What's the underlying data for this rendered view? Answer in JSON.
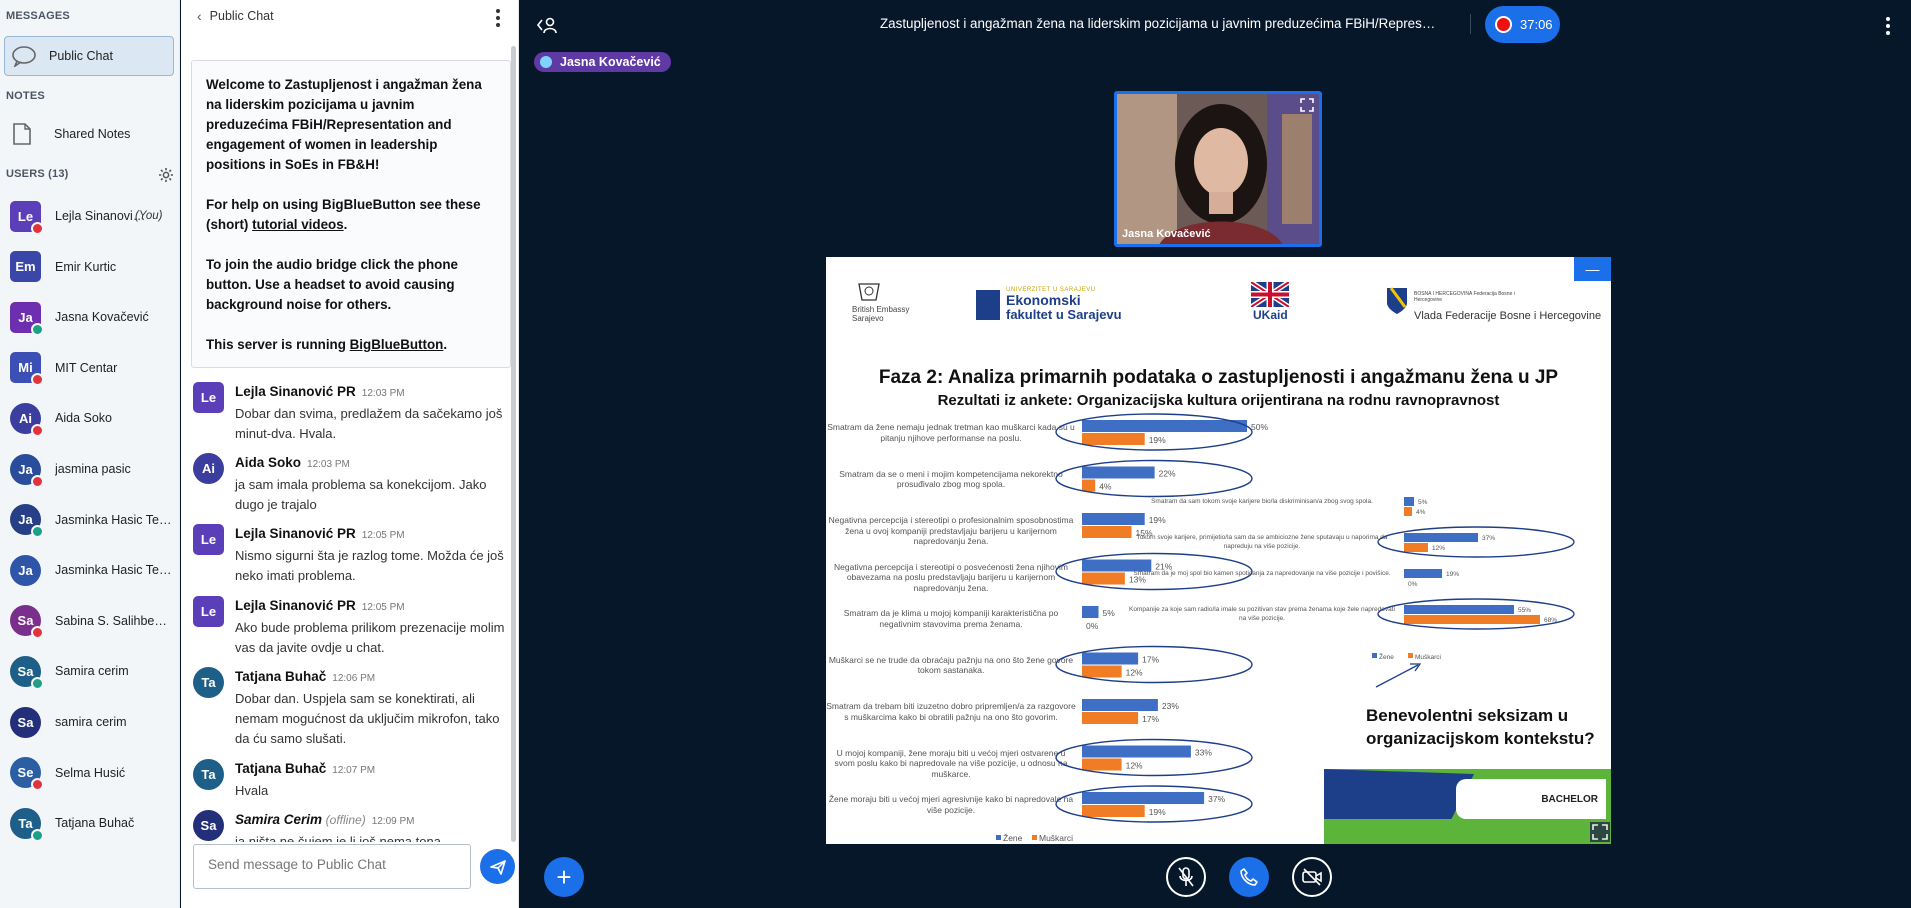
{
  "sidebar": {
    "messages_title": "MESSAGES",
    "public_chat": "Public Chat",
    "notes_title": "NOTES",
    "shared_notes": "Shared Notes",
    "users_title": "USERS (13)",
    "users": [
      {
        "initials": "Le",
        "name": "Lejla Sinanović …",
        "you": "(You)",
        "color": "#5b3fb8",
        "status": "#e0333c",
        "shape": "square"
      },
      {
        "initials": "Em",
        "name": "Emir Kurtic",
        "you": "",
        "color": "#3b47a8",
        "status": "",
        "shape": "square"
      },
      {
        "initials": "Ja",
        "name": "Jasna Kovačević",
        "you": "",
        "color": "#6d2fb0",
        "status": "#1f9f86",
        "shape": "square"
      },
      {
        "initials": "Mi",
        "name": "MIT Centar",
        "you": "",
        "color": "#3b4fb4",
        "status": "#e0333c",
        "shape": "square"
      },
      {
        "initials": "Ai",
        "name": "Aida Soko",
        "you": "",
        "color": "#3b3e9f",
        "status": "#e0333c",
        "shape": "round"
      },
      {
        "initials": "Ja",
        "name": "jasmina pasic",
        "you": "",
        "color": "#2a4d9b",
        "status": "#e0333c",
        "shape": "round"
      },
      {
        "initials": "Ja",
        "name": "Jasminka Hasic Telal…",
        "you": "",
        "color": "#263f86",
        "status": "#1f9f86",
        "shape": "round"
      },
      {
        "initials": "Ja",
        "name": "Jasminka Hasic Telal…",
        "you": "",
        "color": "#2f55a8",
        "status": "",
        "shape": "round"
      },
      {
        "initials": "Sa",
        "name": "Sabina S. Salihbegovic",
        "you": "",
        "color": "#7a2f8c",
        "status": "#e0333c",
        "shape": "round"
      },
      {
        "initials": "Sa",
        "name": "Samira cerim",
        "you": "",
        "color": "#1d5f88",
        "status": "#1f9f86",
        "shape": "round"
      },
      {
        "initials": "Sa",
        "name": "samira cerim",
        "you": "",
        "color": "#242f7a",
        "status": "",
        "shape": "round"
      },
      {
        "initials": "Se",
        "name": "Selma Husić",
        "you": "",
        "color": "#2c5ea4",
        "status": "#e0333c",
        "shape": "round"
      },
      {
        "initials": "Ta",
        "name": "Tatjana Buhač",
        "you": "",
        "color": "#1d5f88",
        "status": "#1f9f86",
        "shape": "round"
      }
    ]
  },
  "chat": {
    "header": "Public Chat",
    "welcome_line1": "Welcome to Zastupljenost i angažman žena na liderskim pozicijama u javnim preduzećima FBiH/Representation and engagement of women in leadership positions in SoEs in FB&H!",
    "welcome_help_pre": "For help on using BigBlueButton see these (short) ",
    "welcome_help_link": "tutorial videos",
    "welcome_audio": "To join the audio bridge click the phone button. Use a headset to avoid causing background noise for others.",
    "welcome_server_pre": "This server is running ",
    "welcome_server_link": "BigBlueButton",
    "messages": [
      {
        "initials": "Le",
        "name": "Lejla Sinanović PR",
        "time": "12:03 PM",
        "text": "Dobar dan svima, predlažem da sačekamo još minut-dva. Hvala.",
        "color": "#5b3fb8"
      },
      {
        "initials": "Ai",
        "name": "Aida Soko",
        "time": "12:03 PM",
        "text": "ja sam imala problema sa konekcijom. Jako dugo je trajalo",
        "color": "#3b3e9f"
      },
      {
        "initials": "Le",
        "name": "Lejla Sinanović PR",
        "time": "12:05 PM",
        "text": "Nismo sigurni šta je razlog tome. Možda će još neko imati problema.",
        "color": "#5b3fb8"
      },
      {
        "initials": "Le",
        "name": "Lejla Sinanović PR",
        "time": "12:05 PM",
        "text": "Ako bude problema prilikom prezenacije molim vas da javite ovdje u chat.",
        "color": "#5b3fb8"
      },
      {
        "initials": "Ta",
        "name": "Tatjana Buhač",
        "time": "12:06 PM",
        "text": "Dobar dan. Uspjela sam se konektirati, ali nemam mogućnost da uključim mikrofon, tako da ću samo slušati.",
        "color": "#1d5f88"
      },
      {
        "initials": "Ta",
        "name": "Tatjana Buhač",
        "time": "12:07 PM",
        "text": "Hvala",
        "color": "#1d5f88"
      },
      {
        "initials": "Sa",
        "name": "Samira Cerim",
        "offline": "(offline)",
        "time": "12:09 PM",
        "text": "ja ništa ne čujem je li još nema tona",
        "color": "#242f7a"
      }
    ],
    "input_placeholder": "Send message to Public Chat"
  },
  "topbar": {
    "title": "Zastupljenost i angažman žena na liderskim pozicijama u javnim preduzećima FBiH/Representation …",
    "timer": "37:06"
  },
  "talker": "Jasna Kovačević",
  "video": {
    "name": "Jasna Kovačević"
  },
  "slide": {
    "logos": {
      "embassy": "British Embassy Sarajevo",
      "univ_top": "UNIVERZITET U SARAJEVU",
      "univ1": "Ekonomski",
      "univ2": "fakultet u Sarajevu",
      "ukaid": "UKaid",
      "vlada_small": "BOSNA I HERCEGOVINA Federacija Bosne i Hercegovine",
      "vlada": "Vlada Federacije Bosne i Hercegovine"
    },
    "title": "Faza 2: Analiza primarnih podataka o zastupljenosti i angažmanu žena u JP",
    "subtitle": "Rezultati iz ankete: Organizacijska kultura orijentirana na rodnu ravnopravnost",
    "callout": "Benevolentni seksizam u organizacijskom kontekstu?",
    "accreditation": "BACHELOR"
  },
  "chart_data": [
    {
      "type": "bar",
      "categories": [
        "Smatram da žene nemaju jednak tretman kao muškarci kada su u pitanju njihove performanse na poslu.",
        "Smatram da se o meni i mojim kompetencijama nekorektno prosuđivalo zbog mog spola.",
        "Negativna percepcija i stereotipi o profesionalnim sposobnostima žena u ovoj kompaniji predstavljaju barijeru u karijernom napredovanju žena.",
        "Negativna percepcija i stereotipi o posvećenosti žena njihovim obavezama na poslu predstavljaju barijeru u karijernom napredovanju žena.",
        "Smatram da je klima u mojoj kompaniji karakteristična po negativnim stavovima prema ženama.",
        "Muškarci se ne trude da obraćaju pažnju na ono što žene govore tokom sastanaka.",
        "Smatram da trebam biti izuzetno dobro pripremljen/a za razgovore s muškarcima kako bi obratili pažnju na ono što govorim.",
        "U mojoj kompaniji, žene moraju biti u većoj mjeri ostvarene u svom poslu kako bi napredovale na više pozicije, u odnosu na muškarce.",
        "Žene moraju biti u većoj mjeri agresivnije kako bi napredovale na više pozicije."
      ],
      "series": [
        {
          "name": "Žene",
          "color": "#3f6fc4",
          "values": [
            50,
            22,
            19,
            21,
            5,
            17,
            23,
            33,
            37
          ]
        },
        {
          "name": "Muškarci",
          "color": "#f07d26",
          "values": [
            19,
            4,
            15,
            13,
            0,
            12,
            17,
            12,
            19
          ]
        }
      ],
      "value_labels_a": [
        "50%",
        "22%",
        "19%",
        "21%",
        "5%",
        "17%",
        "23%",
        "33%",
        "37%"
      ],
      "value_labels_b": [
        "19%",
        "4%",
        "15%",
        "13%",
        "0%",
        "12%",
        "17%",
        "12%",
        "19%"
      ],
      "legend": [
        "Žene",
        "Muškarci"
      ]
    },
    {
      "type": "bar",
      "categories": [
        "Smatram da sam tokom svoje karijere bio/la diskriminisan/a zbog svog spola.",
        "Tokom svoje karijere, primijetio/la sam da se ambiciozne žene sputavaju u naporima da napreduju na više pozicije.",
        "Smatram da je moj spol bio kamen spoticanja za napredovanje na više pozicije i povišice.",
        "Kompanije za koje sam radio/la imale su pozitivan stav prema ženama koje žele napredovati na više pozicije."
      ],
      "series": [
        {
          "name": "Žene",
          "color": "#3f6fc4",
          "values": [
            5,
            37,
            19,
            55
          ]
        },
        {
          "name": "Muškarci",
          "color": "#f07d26",
          "values": [
            4,
            12,
            0,
            68
          ]
        }
      ],
      "value_labels_a": [
        "5%",
        "37%",
        "19%",
        "55%"
      ],
      "value_labels_b": [
        "4%",
        "12%",
        "0%",
        "68%"
      ],
      "legend": [
        "Žene",
        "Muškarci"
      ]
    }
  ]
}
